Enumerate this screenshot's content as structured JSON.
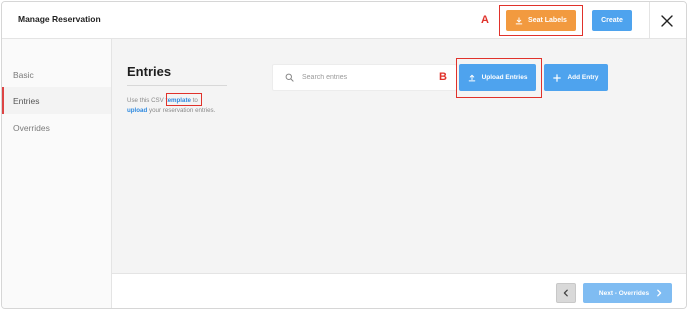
{
  "header": {
    "title": "Manage Reservation",
    "seat_labels": "Seat Labels",
    "create": "Create"
  },
  "annotations": {
    "marker_a": "A",
    "marker_b": "B",
    "highlight_color": "#e0322b"
  },
  "sidebar": {
    "items": [
      {
        "label": "Basic",
        "active": false
      },
      {
        "label": "Entries",
        "active": true
      },
      {
        "label": "Overrides",
        "active": false
      }
    ]
  },
  "main": {
    "title": "Entries",
    "helper": {
      "part1": "Use this CSV ",
      "template_link": "template",
      "part2": " to ",
      "upload_link": "upload",
      "part3": " your reservation entries."
    },
    "search_placeholder": "Search entries",
    "upload_entries": "Upload Entries",
    "add_entry": "Add Entry"
  },
  "footer": {
    "next_label": "Next - Overrides"
  },
  "colors": {
    "primary_blue": "#4ea3ee",
    "orange": "#f29a3f",
    "disabled_blue": "#7fbcf2"
  }
}
